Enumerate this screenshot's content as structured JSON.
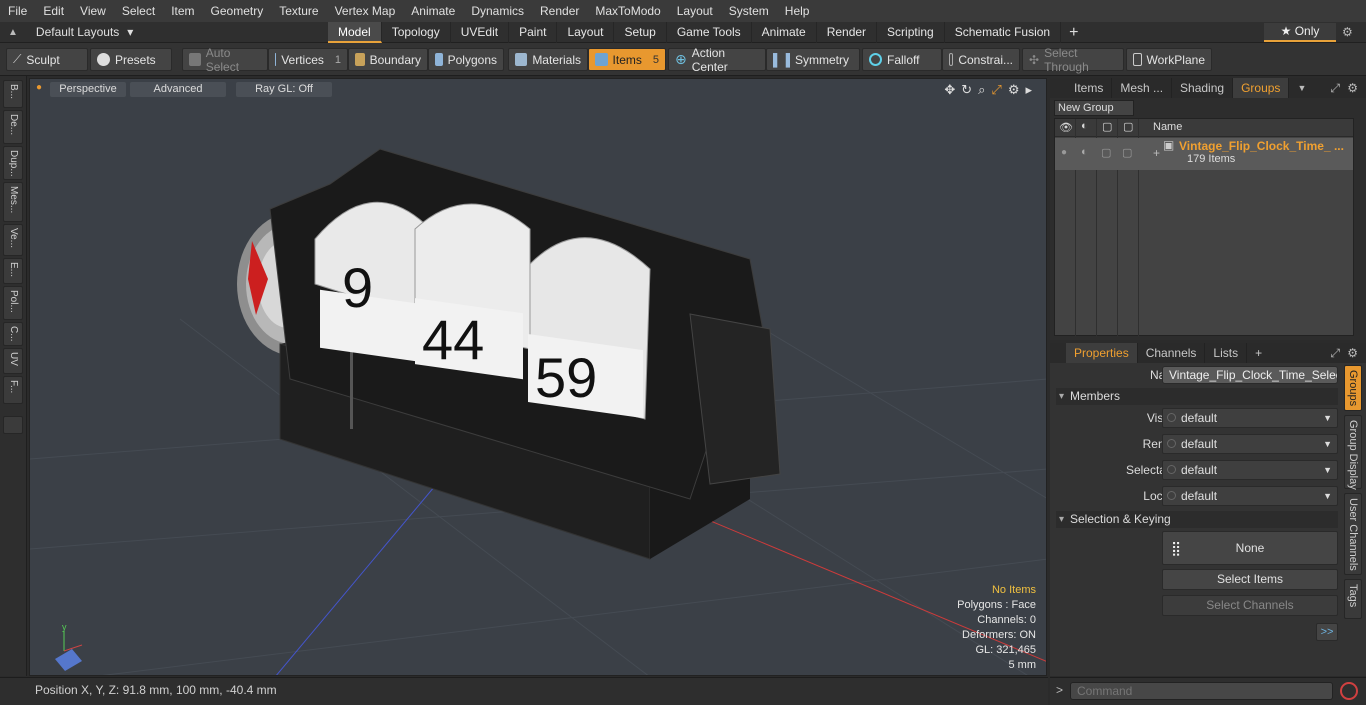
{
  "menu": [
    "File",
    "Edit",
    "View",
    "Select",
    "Item",
    "Geometry",
    "Texture",
    "Vertex Map",
    "Animate",
    "Dynamics",
    "Render",
    "MaxToModo",
    "Layout",
    "System",
    "Help"
  ],
  "layouts": {
    "label": "Default Layouts",
    "arrow": "▾"
  },
  "tabs": [
    "Model",
    "Topology",
    "UVEdit",
    "Paint",
    "Layout",
    "Setup",
    "Game Tools",
    "Animate",
    "Render",
    "Scripting",
    "Schematic Fusion"
  ],
  "tabs_active": "Model",
  "tabs_plus": "+",
  "only_label": "★ Only",
  "toolbar": {
    "sculpt": "Sculpt",
    "presets": "Presets",
    "auto_select": "Auto Select",
    "vertices": "Vertices",
    "vertices_count": "1",
    "boundary": "Boundary",
    "polygons": "Polygons",
    "materials": "Materials",
    "items": "Items",
    "items_count": "5",
    "action_center": "Action Center",
    "symmetry": "Symmetry",
    "falloff": "Falloff",
    "constraints": "Constrai...",
    "select_through": "Select Through",
    "workplane": "WorkPlane"
  },
  "left_tabs": [
    "B...",
    "De...",
    "Dup...",
    "Mes...",
    "Ve...",
    "E...",
    "Pol...",
    "C...",
    "UV",
    "F..."
  ],
  "viewport": {
    "perspective": "Perspective",
    "advanced": "Advanced",
    "raygl": "Ray GL: Off",
    "clock_digits": [
      "9",
      "44",
      "59"
    ],
    "hud": {
      "no_items": "No Items",
      "polygons": "Polygons : Face",
      "channels": "Channels: 0",
      "deformers": "Deformers: ON",
      "gl": "GL: 321,465",
      "scale": "5 mm"
    }
  },
  "status": {
    "position": "Position X, Y, Z:  91.8 mm, 100 mm, -40.4 mm"
  },
  "groups_panel": {
    "tabs": [
      "Items",
      "Mesh ...",
      "Shading",
      "Groups"
    ],
    "active_tab": "Groups",
    "new_group": "New Group",
    "col_name": "Name",
    "group_name": "Vintage_Flip_Clock_Time_ ...",
    "group_count": "179 Items"
  },
  "properties_panel": {
    "tabs": [
      "Properties",
      "Channels",
      "Lists"
    ],
    "plus": "+",
    "name_label": "Name",
    "name_value": "Vintage_Flip_Clock_Time_Selected",
    "members_section": "Members",
    "visible_label": "Visible",
    "render_label": "Render",
    "selectable_label": "Selectable",
    "locked_label": "Locked",
    "default_value": "default",
    "selection_section": "Selection & Keying",
    "none_label": "None",
    "select_items": "Select Items",
    "select_channels": "Select Channels",
    "more": ">>",
    "side_tabs": [
      "Groups",
      "Group Display",
      "User Channels",
      "Tags"
    ]
  },
  "command": {
    "placeholder": "Command",
    "prompt": ">"
  },
  "colors": {
    "accent": "#e8982f",
    "viewport_bg": "#3b4047",
    "group_highlight": "#f0a030"
  }
}
